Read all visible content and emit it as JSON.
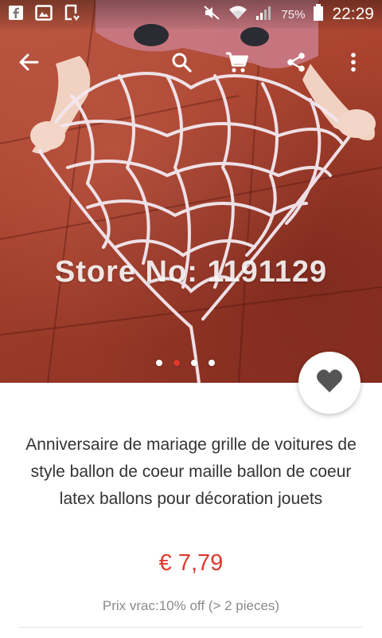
{
  "status_bar": {
    "battery_percent": "75%",
    "time": "22:29"
  },
  "hero": {
    "watermark": "Store No: 1191129",
    "image_count": 4,
    "active_index": 1
  },
  "product": {
    "title": "Anniversaire de mariage grille de voitures de style ballon de coeur maille ballon de coeur latex ballons pour décoration jouets",
    "price": "€ 7,79",
    "bulk_price_note": "Prix vrac:10% off (> 2 pieces)"
  },
  "colors": {
    "price_red": "#e0392e",
    "title_text": "#333333",
    "muted_text": "#8a8a8a",
    "fab_heart": "#555555"
  },
  "icons": {
    "back": "arrow-back-icon",
    "search": "search-icon",
    "cart": "cart-icon",
    "share": "share-icon",
    "more": "more-vert-icon",
    "favorite": "heart-icon"
  }
}
